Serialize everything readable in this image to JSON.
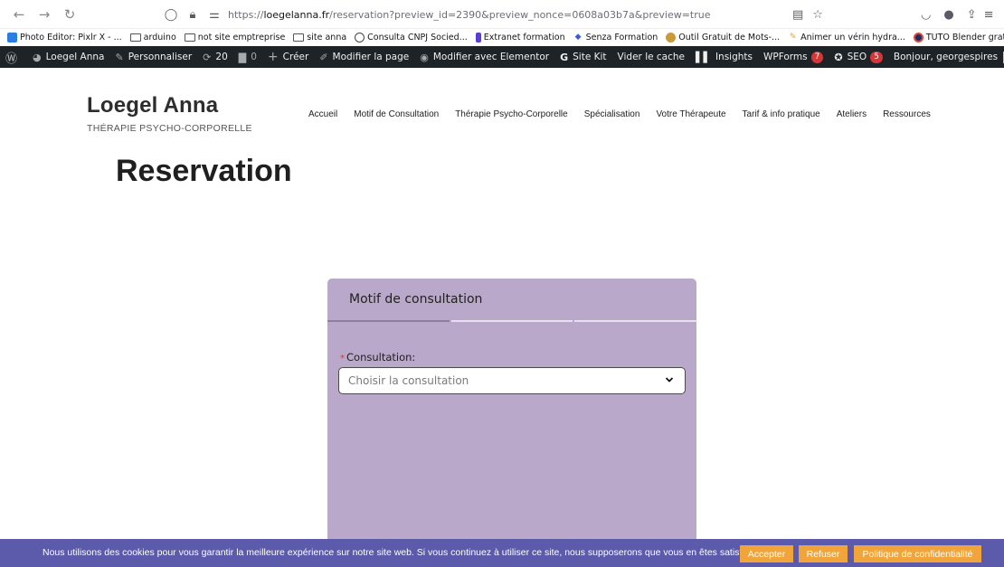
{
  "browser": {
    "url_prefix": "https://",
    "url_host": "loegelanna.fr",
    "url_path": "/reservation?preview_id=2390&preview_nonce=0608a03b7a&preview=true"
  },
  "bookmarks": [
    {
      "label": "Photo Editor: Pixlr X - ...",
      "icon": "pixlr-icon"
    },
    {
      "label": "arduino",
      "icon": "folder-icon"
    },
    {
      "label": "not site emptreprise",
      "icon": "folder-icon"
    },
    {
      "label": "site anna",
      "icon": "folder-icon"
    },
    {
      "label": "Consulta CNPJ Socied...",
      "icon": "globe-icon"
    },
    {
      "label": "Extranet formation",
      "icon": "extranet-icon"
    },
    {
      "label": "Senza Formation",
      "icon": "senza-icon"
    },
    {
      "label": "Outil Gratuit de Mots-...",
      "icon": "outil-icon"
    },
    {
      "label": "Animer un vérin hydra...",
      "icon": "verin-icon"
    },
    {
      "label": "TUTO Blender gratuit, ...",
      "icon": "tuto-icon"
    }
  ],
  "adminbar": {
    "site_name": "Loegel Anna",
    "customize": "Personnaliser",
    "updates": "20",
    "comments": "0",
    "new": "Créer",
    "edit_page": "Modifier la page",
    "elementor": "Modifier avec Elementor",
    "sitekit": "Site Kit",
    "clear_cache": "Vider le cache",
    "insights": "Insights",
    "wpforms": "WPForms",
    "wpforms_count": "7",
    "seo": "SEO",
    "seo_count": "5",
    "greeting": "Bonjour, georgespires"
  },
  "site": {
    "title": "Loegel Anna",
    "tagline": "THÉRAPIE PSYCHO-CORPORELLE",
    "nav": [
      "Accueil",
      "Motif de Consultation",
      "Thérapie Psycho-Corporelle",
      "Spécialisation",
      "Votre Thérapeute",
      "Tarif & info pratique",
      "Ateliers",
      "Ressources"
    ]
  },
  "page": {
    "title": "Reservation"
  },
  "form": {
    "step_title": "Motif de consultation",
    "required_mark": "*",
    "field_label": "Consultation:",
    "select_placeholder": "Choisir la consultation"
  },
  "cookie": {
    "text": "Nous utilisons des cookies pour vous garantir la meilleure expérience sur notre site web. Si vous continuez à utiliser ce site, nous supposerons que vous en êtes satisfait.",
    "accept": "Accepter",
    "refuse": "Refuser",
    "policy": "Politique de confidentialité"
  },
  "colors": {
    "form_bg": "#b9a8c9",
    "cookie_bg": "#5c5aaa",
    "cookie_btn": "#f0a43a",
    "adminbar_bg": "#1d2327",
    "badge": "#d63638"
  }
}
